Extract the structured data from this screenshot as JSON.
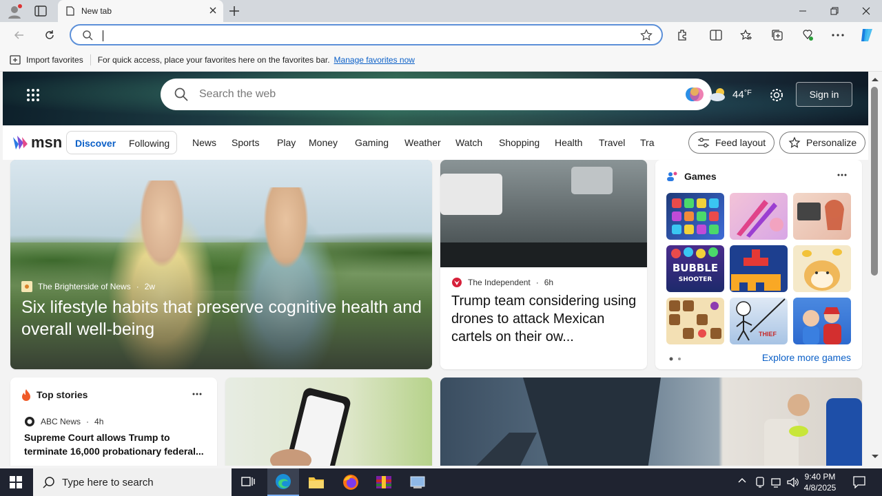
{
  "browser": {
    "tab_title": "New tab",
    "address_value": "",
    "favbar": {
      "import_label": "Import favorites",
      "hint": "For quick access, place your favorites here on the favorites bar.",
      "manage_link": "Manage favorites now"
    }
  },
  "msn": {
    "search_placeholder": "Search the web",
    "temperature": "44",
    "temp_unit": "°F",
    "signin": "Sign in",
    "logo_text": "msn",
    "tabs": {
      "discover": "Discover",
      "following": "Following"
    },
    "nav_items": [
      "News",
      "Sports",
      "Play",
      "Money",
      "Gaming",
      "Weather",
      "Watch",
      "Shopping",
      "Health",
      "Travel",
      "Tra"
    ],
    "feed_layout": "Feed layout",
    "personalize": "Personalize",
    "main_story": {
      "source": "The Brighterside of News",
      "age": "2w",
      "title": "Six lifestyle habits that preserve cognitive health and overall well-being"
    },
    "story2": {
      "source": "The Independent",
      "age": "6h",
      "title": "Trump team considering using drones to attack Mexican cartels on their ow..."
    },
    "games": {
      "title": "Games",
      "explore": "Explore more games",
      "tile_texts": [
        "BUBBLE",
        "SHOOTER",
        "THIEF"
      ]
    },
    "top_stories": {
      "title": "Top stories",
      "source": "ABC News",
      "age": "4h",
      "title_text": "Supreme Court allows Trump to terminate 16,000 probationary federal..."
    }
  },
  "taskbar": {
    "search_placeholder": "Type here to search",
    "time": "9:40 PM",
    "date": "4/8/2025"
  },
  "colors": {
    "accent": "#0a5fc7",
    "taskbar": "#1f2330"
  }
}
